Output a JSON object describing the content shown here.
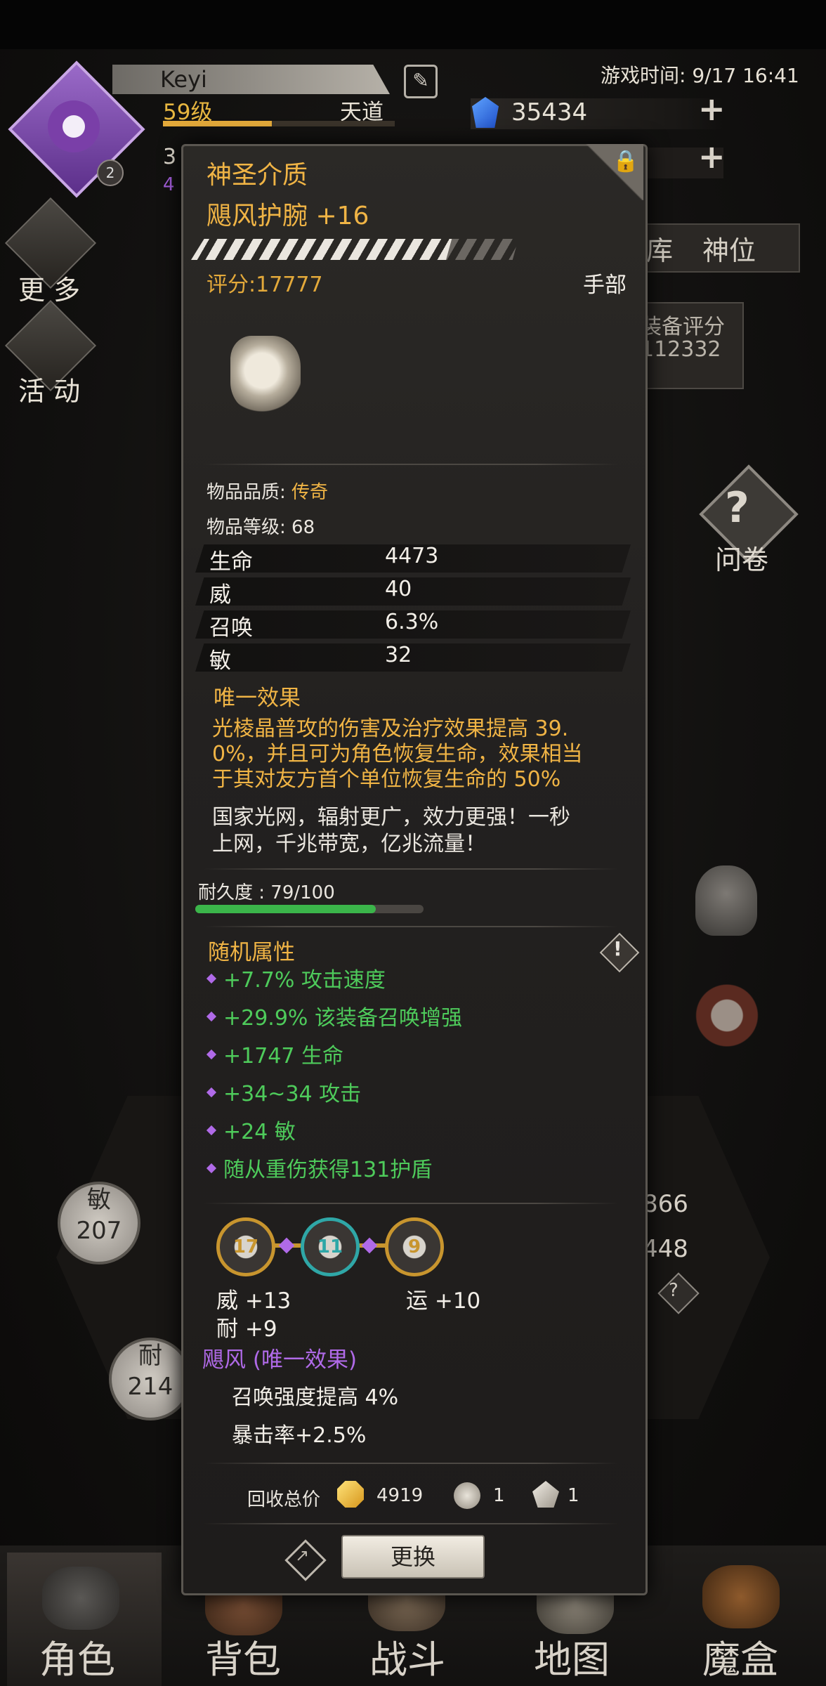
{
  "status": {
    "game_time": "游戏时间: 9/17 16:41"
  },
  "player": {
    "name": "Keyi",
    "level": "59级",
    "realm": "天道",
    "badge": "2",
    "currency": "35434",
    "peek_line1": "3",
    "peek_line2": "4"
  },
  "side_menu": {
    "more_label": "更 多",
    "activity_label": "活 动"
  },
  "right_panel": {
    "tabs": [
      "库",
      "神位"
    ],
    "score_title": "装备评分",
    "score_value": "112332",
    "survey_label": "问卷",
    "right_stat_1": "866",
    "right_stat_2": "448"
  },
  "stats_wheel": {
    "agi_label": "敏",
    "agi_value": "207",
    "end_label": "耐",
    "end_value": "214"
  },
  "bottom_nav": [
    "角色",
    "背包",
    "战斗",
    "地图",
    "魔盒"
  ],
  "item": {
    "category": "神圣介质",
    "name": "飓风护腕 +16",
    "rating": "评分:17777",
    "slot": "手部",
    "upgrade_progress": 0.75,
    "quality_label": "物品品质:",
    "quality_value": "传奇",
    "item_level": "物品等级: 68",
    "stats": [
      {
        "name": "生命",
        "value": "4473",
        "highlight": false
      },
      {
        "name": "威",
        "value": "40",
        "highlight": false
      },
      {
        "name": "召唤",
        "value": "6.3%",
        "highlight": true
      },
      {
        "name": "敏",
        "value": "32",
        "highlight": false
      }
    ],
    "unique_title": "唯一效果",
    "unique_line1": "光棱晶普攻的伤害及治疗效果提高 39.",
    "unique_line2": "0%，并且可为角色恢复生命，效果相当",
    "unique_line3": "于其对友方首个单位恢复生命的 50%",
    "flavor_line1": "国家光网，辐射更广，效力更强！一秒",
    "flavor_line2": "上网，千兆带宽，亿兆流量！",
    "durability": "耐久度 : 79/100",
    "durability_fraction": 0.79,
    "random_title": "随机属性",
    "random_attrs": [
      "+7.7% 攻击速度",
      "+29.9% 该装备召唤增强",
      "+1747 生命",
      "+34~34 攻击",
      "+24 敏",
      "随从重伤获得131护盾"
    ],
    "gems": [
      "17",
      "11",
      "9"
    ],
    "gem_stats": {
      "wei": "威  +13",
      "luck": "运  +10",
      "nai": "耐  +9"
    },
    "set_name": "飓风 (唯一效果)",
    "set_line1": "召唤强度提高 4%",
    "set_line2": "暴击率+2.5%",
    "recycle_label": "回收总价",
    "recycle_gold": "4919",
    "recycle_item1": "1",
    "recycle_item2": "1",
    "replace_label": "更换"
  },
  "colors": {
    "gold": "#f0b445",
    "green": "#4ecb5b",
    "purple": "#b06ae8"
  }
}
